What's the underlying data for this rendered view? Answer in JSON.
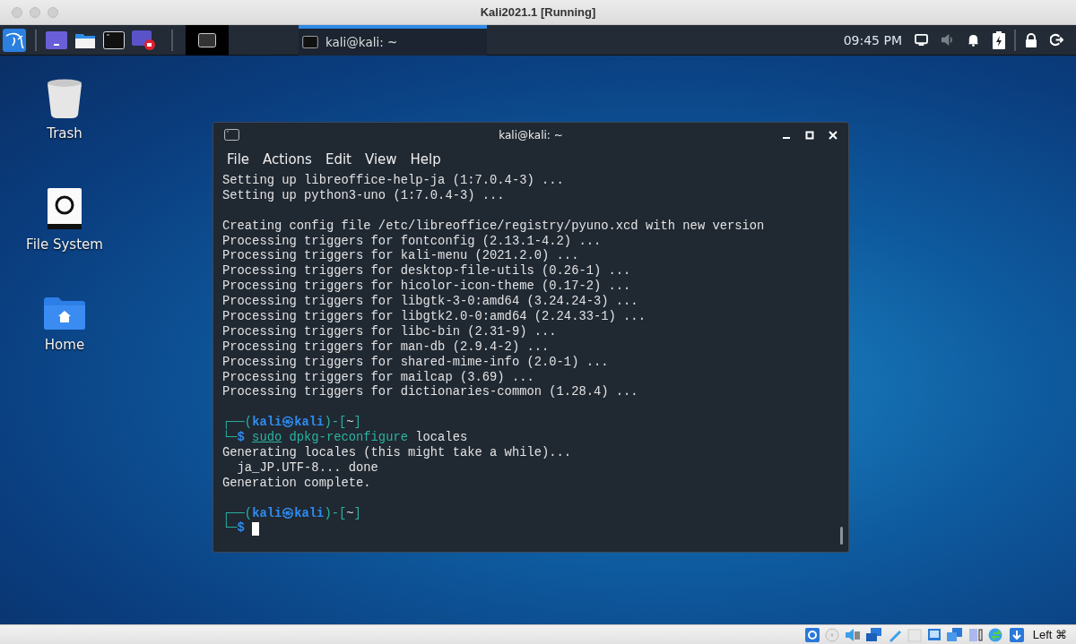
{
  "window": {
    "title": "Kali2021.1 [Running]"
  },
  "panel": {
    "task": {
      "label": "kali@kali: ~",
      "selected": true
    },
    "clock": "09:45 PM",
    "volume": {
      "muted": true
    }
  },
  "desktop_icons": [
    {
      "label": "Trash",
      "kind": "trash"
    },
    {
      "label": "File System",
      "kind": "drive"
    },
    {
      "label": "Home",
      "kind": "home"
    }
  ],
  "terminal": {
    "title": "kali@kali: ~",
    "menu": [
      "File",
      "Actions",
      "Edit",
      "View",
      "Help"
    ],
    "lines": [
      {
        "kind": "output",
        "text": "Setting up libreoffice-help-ja (1:7.0.4-3) ..."
      },
      {
        "kind": "output",
        "text": "Setting up python3-uno (1:7.0.4-3) ..."
      },
      {
        "kind": "blank"
      },
      {
        "kind": "output",
        "text": "Creating config file /etc/libreoffice/registry/pyuno.xcd with new version"
      },
      {
        "kind": "output",
        "text": "Processing triggers for fontconfig (2.13.1-4.2) ..."
      },
      {
        "kind": "output",
        "text": "Processing triggers for kali-menu (2021.2.0) ..."
      },
      {
        "kind": "output",
        "text": "Processing triggers for desktop-file-utils (0.26-1) ..."
      },
      {
        "kind": "output",
        "text": "Processing triggers for hicolor-icon-theme (0.17-2) ..."
      },
      {
        "kind": "output",
        "text": "Processing triggers for libgtk-3-0:amd64 (3.24.24-3) ..."
      },
      {
        "kind": "output",
        "text": "Processing triggers for libgtk2.0-0:amd64 (2.24.33-1) ..."
      },
      {
        "kind": "output",
        "text": "Processing triggers for libc-bin (2.31-9) ..."
      },
      {
        "kind": "output",
        "text": "Processing triggers for man-db (2.9.4-2) ..."
      },
      {
        "kind": "output",
        "text": "Processing triggers for shared-mime-info (2.0-1) ..."
      },
      {
        "kind": "output",
        "text": "Processing triggers for mailcap (3.69) ..."
      },
      {
        "kind": "output",
        "text": "Processing triggers for dictionaries-common (1.28.4) ..."
      },
      {
        "kind": "blank"
      },
      {
        "kind": "prompt",
        "open": "┌──(",
        "user": "kali㉿kali",
        "mid": ")-[",
        "dir": "~",
        "close": "]"
      },
      {
        "kind": "command",
        "corner": "└─",
        "sigil": "$",
        "sudo": "sudo",
        "program": "dpkg-reconfigure",
        "args": "locales"
      },
      {
        "kind": "output",
        "text": "Generating locales (this might take a while)..."
      },
      {
        "kind": "output",
        "text": "  ja_JP.UTF-8... done"
      },
      {
        "kind": "output",
        "text": "Generation complete."
      },
      {
        "kind": "blank"
      },
      {
        "kind": "prompt",
        "open": "┌──(",
        "user": "kali㉿kali",
        "mid": ")-[",
        "dir": "~",
        "close": "]"
      },
      {
        "kind": "command",
        "corner": "└─",
        "sigil": "$",
        "cursor": true
      }
    ]
  },
  "status_bar": {
    "host_key": "Left ⌘"
  }
}
